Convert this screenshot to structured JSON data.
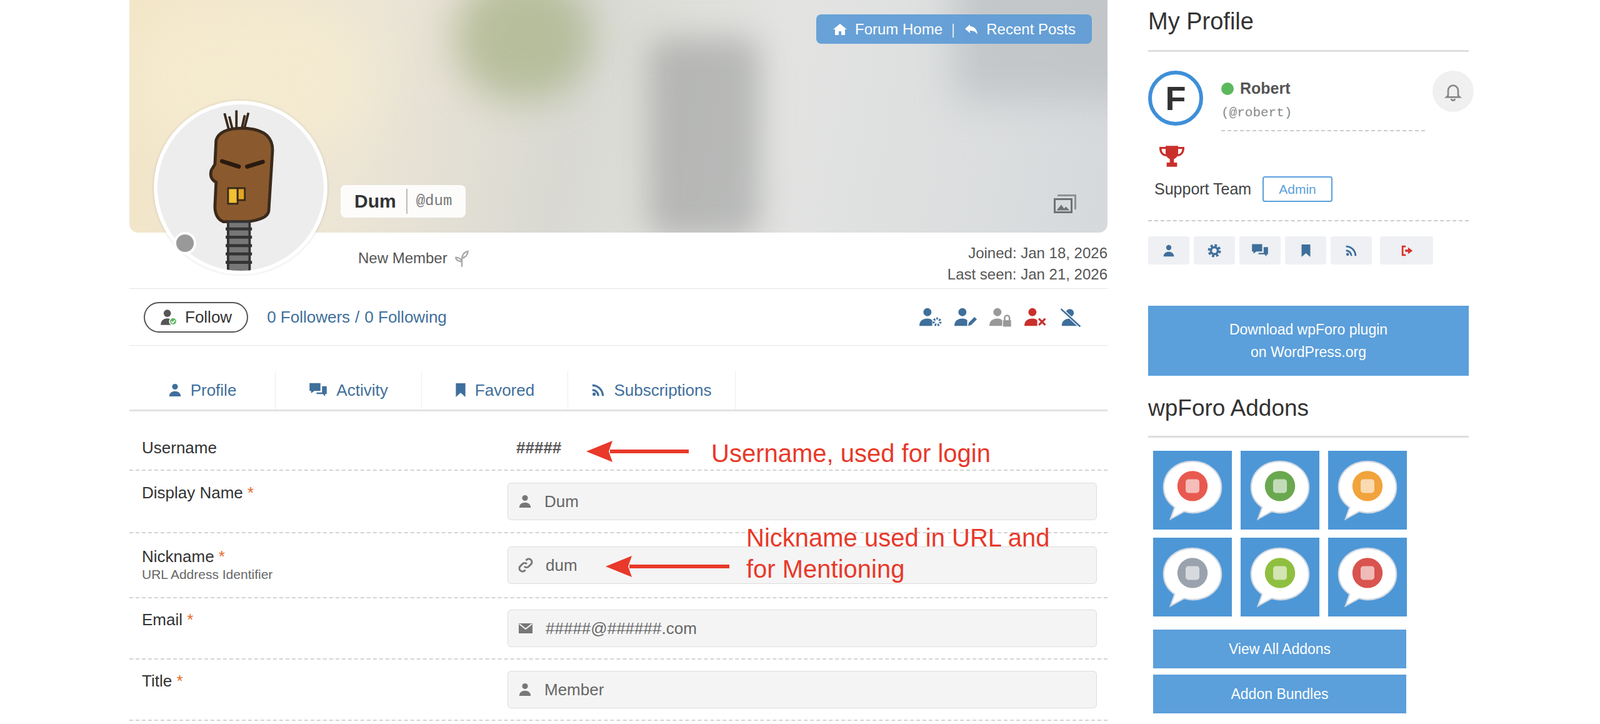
{
  "nav": {
    "forum_home": "Forum Home",
    "separator": "|",
    "recent_posts": "Recent Posts"
  },
  "profile": {
    "display_name": "Dum",
    "handle": "@dum",
    "online": false,
    "rank": "New Member",
    "joined": "Joined: Jan 18, 2026",
    "last_seen": "Last seen: Jan 21, 2026"
  },
  "follow": {
    "button": "Follow",
    "followers": "0 Followers",
    "separator": "/",
    "following": "0 Following"
  },
  "tabs": [
    {
      "label": "Profile"
    },
    {
      "label": "Activity"
    },
    {
      "label": "Favored"
    },
    {
      "label": "Subscriptions"
    }
  ],
  "form": {
    "required_mark": "*"
  },
  "fields": [
    {
      "label": "Username",
      "required": false,
      "value": "#####"
    },
    {
      "label": "Display Name",
      "required": true,
      "value": "Dum"
    },
    {
      "label": "Nickname",
      "required": true,
      "sublabel": "URL Address Identifier",
      "value": "dum"
    },
    {
      "label": "Email",
      "required": true,
      "value": "#####@######.com"
    },
    {
      "label": "Title",
      "required": true,
      "value": "Member"
    }
  ],
  "annotations": [
    {
      "lines": [
        "Username, used for login"
      ]
    },
    {
      "lines": [
        "Nickname used in URL and",
        "for Mentioning"
      ]
    }
  ],
  "sidebar": {
    "title": "My Profile",
    "user": {
      "avatar_letter": "F",
      "name": "Robert",
      "handle": "(@robert)",
      "online": true,
      "group": "Support Team",
      "role": "Admin"
    },
    "download": {
      "lines": [
        "Download wpForo plugin",
        "on WordPress.org"
      ]
    },
    "addons_title": "wpForo Addons",
    "buttons": [
      "View All Addons",
      "Addon Bundles"
    ]
  }
}
